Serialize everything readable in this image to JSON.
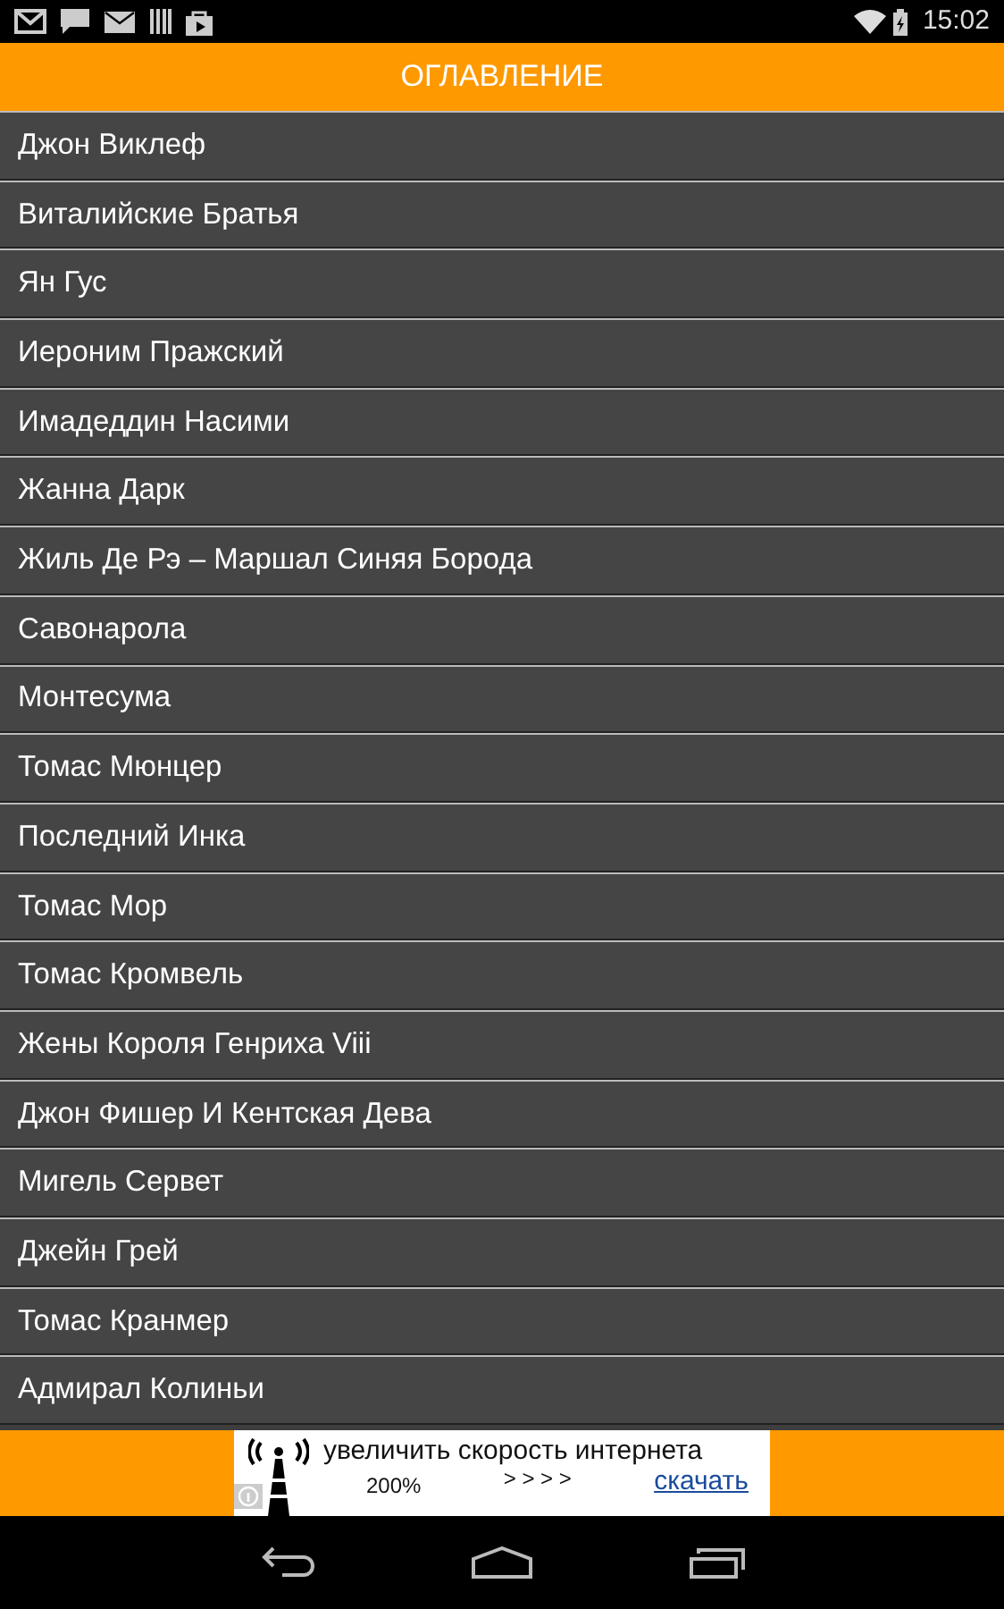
{
  "status_bar": {
    "time": "15:02"
  },
  "header": {
    "title": "ОГЛАВЛЕНИЕ"
  },
  "items": [
    {
      "label": "Джон Виклеф"
    },
    {
      "label": "Виталийские Братья"
    },
    {
      "label": "Ян Гус"
    },
    {
      "label": "Иероним Пражский"
    },
    {
      "label": "Имадеддин Насими"
    },
    {
      "label": "Жанна Дарк"
    },
    {
      "label": "Жиль Де Рэ – Маршал Синяя Борода"
    },
    {
      "label": "Савонарола"
    },
    {
      "label": "Монтесума"
    },
    {
      "label": "Томас Мюнцер"
    },
    {
      "label": "Последний Инка"
    },
    {
      "label": "Томас Мор"
    },
    {
      "label": "Томас Кромвель"
    },
    {
      "label": "Жены Короля Генриха Viii"
    },
    {
      "label": "Джон Фишер И Кентская Дева"
    },
    {
      "label": "Мигель Сервет"
    },
    {
      "label": "Джейн Грей"
    },
    {
      "label": "Томас Кранмер"
    },
    {
      "label": "Адмирал Колиньи"
    }
  ],
  "ad": {
    "headline": "увеличить скорость интернета",
    "percent": "200%",
    "arrows": "> > > >",
    "link": "скачать"
  }
}
